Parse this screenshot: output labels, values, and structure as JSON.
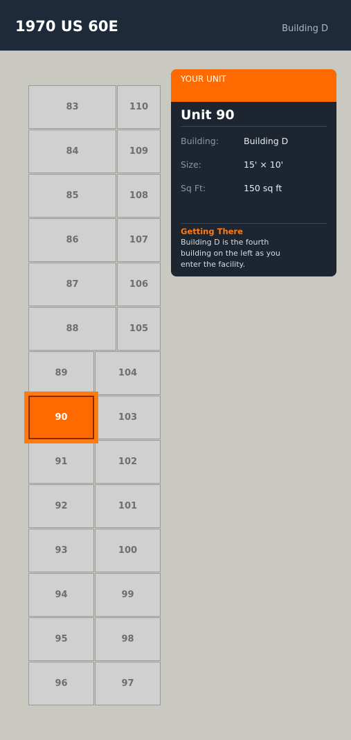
{
  "header": {
    "title": "1970 US 60E",
    "building_label": "Building D"
  },
  "map": {
    "selected_unit": "90",
    "units": [
      "83",
      "84",
      "85",
      "86",
      "87",
      "88",
      "110",
      "109",
      "108",
      "107",
      "106",
      "105",
      "89",
      "90",
      "91",
      "92",
      "93",
      "94",
      "95",
      "96",
      "104",
      "103",
      "102",
      "101",
      "100",
      "99",
      "98",
      "97"
    ]
  },
  "info_card": {
    "eyebrow": "YOUR UNIT",
    "title": "Unit 90",
    "rows": [
      {
        "label": "Building:",
        "value": "Building D"
      },
      {
        "label": "Size:",
        "value": "15' × 10'"
      },
      {
        "label": "Sq Ft:",
        "value": "150 sq ft"
      }
    ],
    "directions_title": "Getting There",
    "directions_text": "Building D is the fourth building on the left as you enter the facility."
  },
  "colors": {
    "header_bg": "#1c2a3a",
    "page_bg": "#c9c9c1",
    "accent": "#ff6a00",
    "card_bg": "#1c2530",
    "unit_bg": "#d0d0d0"
  }
}
